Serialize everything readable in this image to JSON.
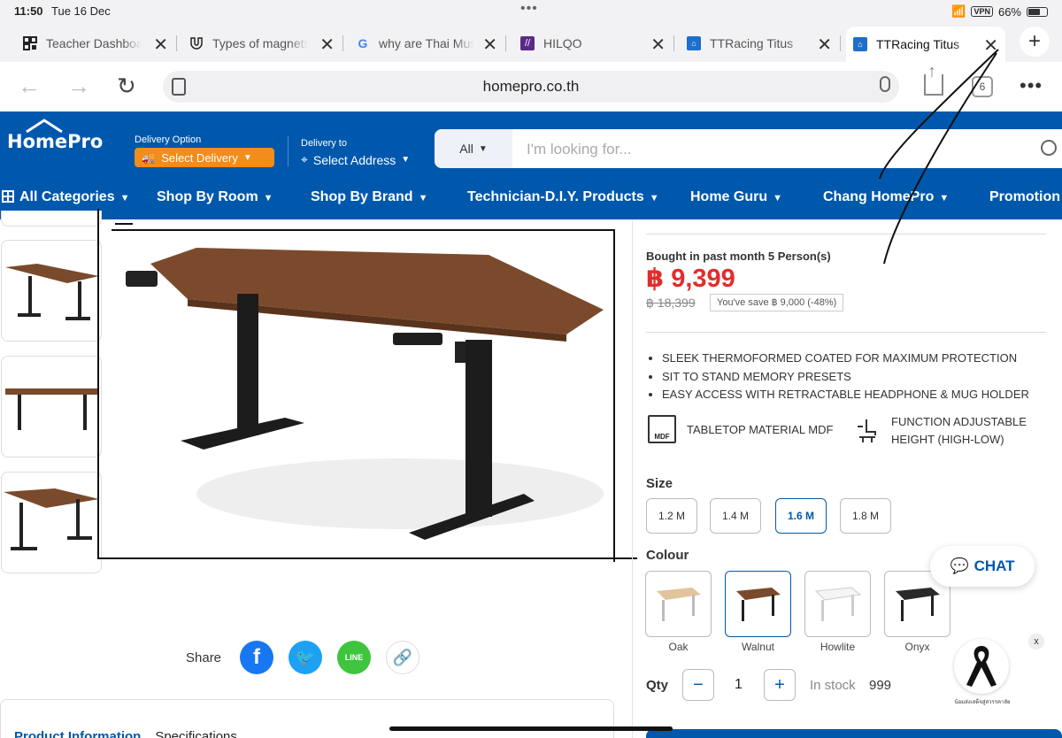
{
  "status": {
    "time": "11:50",
    "date": "Tue 16 Dec",
    "vpn": "VPN",
    "battery": "66%",
    "battery_level": 0.66
  },
  "tabs": [
    {
      "title": "Teacher Dashboard",
      "icon": "qr-icon"
    },
    {
      "title": "Types of magnets",
      "icon": "magnet-icon"
    },
    {
      "title": "why are Thai Muslims",
      "icon": "google-icon"
    },
    {
      "title": "HILQO",
      "icon": "hilqo-icon"
    },
    {
      "title": "TTRacing Titus",
      "icon": "ttracing-icon"
    },
    {
      "title": "TTRacing Titus",
      "icon": "ttracing-icon",
      "active": true
    }
  ],
  "address": {
    "url": "homepro.co.th",
    "tab_count": "6"
  },
  "header": {
    "logo": "HomePro",
    "delivery_option_label": "Delivery Option",
    "select_delivery": "Select Delivery",
    "delivery_to_label": "Delivery to",
    "select_address": "Select Address",
    "search_scope": "All",
    "search_placeholder": "I'm looking for..."
  },
  "nav": {
    "all_categories": "All Categories",
    "items": [
      "Shop By Room",
      "Shop By Brand",
      "Technician-D.I.Y. Products",
      "Home Guru",
      "Chang HomePro",
      "Promotion"
    ]
  },
  "share": {
    "label": "Share"
  },
  "info_tabs": [
    "Product Information",
    "Specifications"
  ],
  "product": {
    "bought": "Bought in past month 5 Person(s)",
    "price": "฿ 9,399",
    "old_price": "฿ 18,399",
    "save": "You've save ฿ 9,000 (-48%)",
    "features": [
      "SLEEK THERMOFORMED COATED FOR MAXIMUM PROTECTION",
      "SIT TO STAND MEMORY PRESETS",
      "EASY ACCESS WITH RETRACTABLE HEADPHONE & MUG HOLDER"
    ],
    "attr_tabletop": "TABLETOP MATERIAL MDF",
    "attr_tabletop_icon_text": "MDF",
    "attr_function_1": "FUNCTION ADJUSTABLE",
    "attr_function_2": "HEIGHT (HIGH-LOW)",
    "size_label": "Size",
    "sizes": [
      "1.2 M",
      "1.4 M",
      "1.6 M",
      "1.8 M"
    ],
    "selected_size": "1.6 M",
    "colour_label": "Colour",
    "colours": [
      {
        "name": "Oak",
        "hex": "#e2c49c"
      },
      {
        "name": "Walnut",
        "hex": "#7a4a2c"
      },
      {
        "name": "Howlite",
        "hex": "#f2f2f2"
      },
      {
        "name": "Onyx",
        "hex": "#2a2a2a"
      }
    ],
    "selected_colour": "Walnut",
    "qty_label": "Qty",
    "qty": "1",
    "in_stock_label": "In stock",
    "stock": "999"
  },
  "chat": {
    "label": "CHAT"
  },
  "mourning": {
    "close": "x",
    "text": "น้อมส่งเสด็จสู่สวรรคาลัย"
  },
  "colors": {
    "brand": "#0058ad",
    "accent": "#f28c1b",
    "price": "#e12c2c"
  }
}
